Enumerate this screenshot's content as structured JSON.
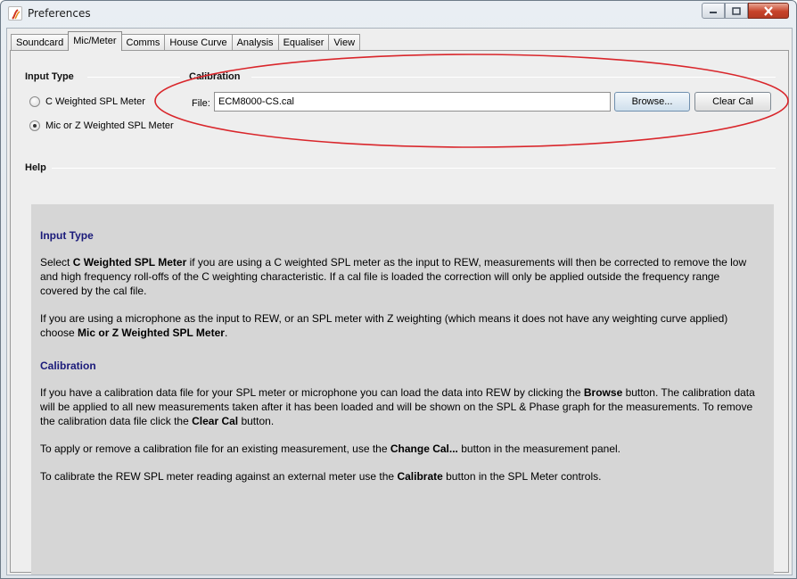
{
  "window": {
    "title": "Preferences",
    "colors": {
      "accent_circle": "#d9262b",
      "help_heading": "#1a1a7a",
      "close_button": "#c7432a"
    }
  },
  "tabs": [
    {
      "label": "Soundcard"
    },
    {
      "label": "Mic/Meter",
      "active": true
    },
    {
      "label": "Comms"
    },
    {
      "label": "House Curve"
    },
    {
      "label": "Analysis"
    },
    {
      "label": "Equaliser"
    },
    {
      "label": "View"
    }
  ],
  "input_type": {
    "title": "Input Type",
    "options": [
      {
        "label": "C Weighted SPL Meter",
        "selected": false
      },
      {
        "label": "Mic or Z Weighted SPL Meter",
        "selected": true
      }
    ]
  },
  "calibration": {
    "title": "Calibration",
    "file_label": "File:",
    "file_value": "ECM8000-CS.cal",
    "browse_label": "Browse...",
    "clear_label": "Clear Cal"
  },
  "help": {
    "title": "Help",
    "sections": [
      {
        "heading": "Input Type",
        "paragraphs": [
          [
            {
              "t": "Select "
            },
            {
              "t": "C Weighted SPL Meter",
              "b": true
            },
            {
              "t": " if you are using a C weighted SPL meter as the input to REW, measurements will then be corrected to remove the low and high frequency roll-offs of the C weighting characteristic. If a cal file is loaded the correction will only be applied outside the frequency range covered by the cal file."
            }
          ],
          [
            {
              "t": "If you are using a microphone as the input to REW, or an SPL meter with Z weighting (which means it does not have any weighting curve applied) choose "
            },
            {
              "t": "Mic or Z Weighted SPL Meter",
              "b": true
            },
            {
              "t": "."
            }
          ]
        ]
      },
      {
        "heading": "Calibration",
        "paragraphs": [
          [
            {
              "t": "If you have a calibration data file for your SPL meter or microphone you can load the data into REW by clicking the "
            },
            {
              "t": "Browse",
              "b": true
            },
            {
              "t": " button. The calibration data will be applied to all new measurements taken after it has been loaded and will be shown on the SPL & Phase graph for the measurements. To remove the calibration data file click the "
            },
            {
              "t": "Clear Cal",
              "b": true
            },
            {
              "t": " button."
            }
          ],
          [
            {
              "t": "To apply or remove a calibration file for an existing measurement, use the "
            },
            {
              "t": "Change Cal...",
              "b": true
            },
            {
              "t": " button in the measurement panel."
            }
          ],
          [
            {
              "t": "To calibrate the REW SPL meter reading against an external meter use the "
            },
            {
              "t": "Calibrate",
              "b": true
            },
            {
              "t": " button in the SPL Meter controls."
            }
          ]
        ]
      }
    ]
  }
}
